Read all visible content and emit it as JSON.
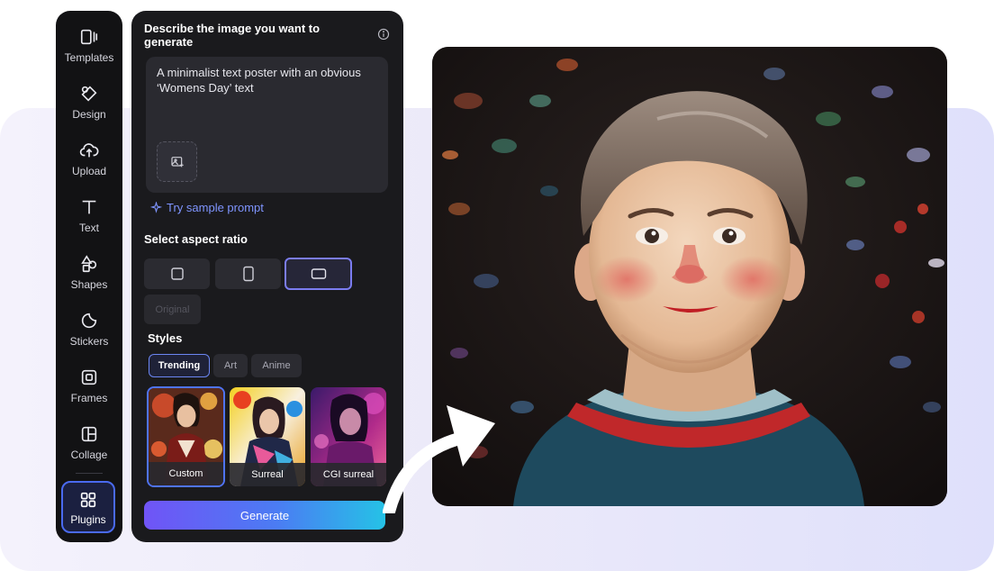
{
  "sidebar": {
    "items": [
      {
        "label": "Templates",
        "icon": "templates-icon"
      },
      {
        "label": "Design",
        "icon": "design-icon"
      },
      {
        "label": "Upload",
        "icon": "upload-icon"
      },
      {
        "label": "Text",
        "icon": "text-icon"
      },
      {
        "label": "Shapes",
        "icon": "shapes-icon"
      },
      {
        "label": "Stickers",
        "icon": "stickers-icon"
      },
      {
        "label": "Frames",
        "icon": "frames-icon"
      },
      {
        "label": "Collage",
        "icon": "collage-icon"
      },
      {
        "label": "Plugins",
        "icon": "plugins-icon"
      }
    ]
  },
  "panel": {
    "title": "Describe the image you want to generate",
    "prompt_text": "A minimalist text poster with an obvious ‘Womens Day’ text",
    "sample_prompt_link": "Try sample prompt",
    "aspect_ratio_label": "Select aspect ratio",
    "aspect_ratios": [
      {
        "shape": "square",
        "selected": false
      },
      {
        "shape": "portrait",
        "selected": false
      },
      {
        "shape": "landscape",
        "selected": true
      }
    ],
    "original_label": "Original",
    "styles_label": "Styles",
    "style_tabs": [
      {
        "label": "Trending",
        "active": true
      },
      {
        "label": "Art",
        "active": false
      },
      {
        "label": "Anime",
        "active": false
      }
    ],
    "style_cards": [
      {
        "label": "Custom",
        "selected": true
      },
      {
        "label": "Surreal",
        "selected": false
      },
      {
        "label": "CGI surreal",
        "selected": false
      }
    ],
    "generate_label": "Generate"
  },
  "colors": {
    "accent": "#4f74f7",
    "generate_gradient_start": "#7054f6",
    "generate_gradient_end": "#25c2e6",
    "link": "#7f95ff",
    "panel_bg": "#1a1a1d"
  },
  "result_image": {
    "subject": "illustrated portrait of a smiling boy"
  }
}
